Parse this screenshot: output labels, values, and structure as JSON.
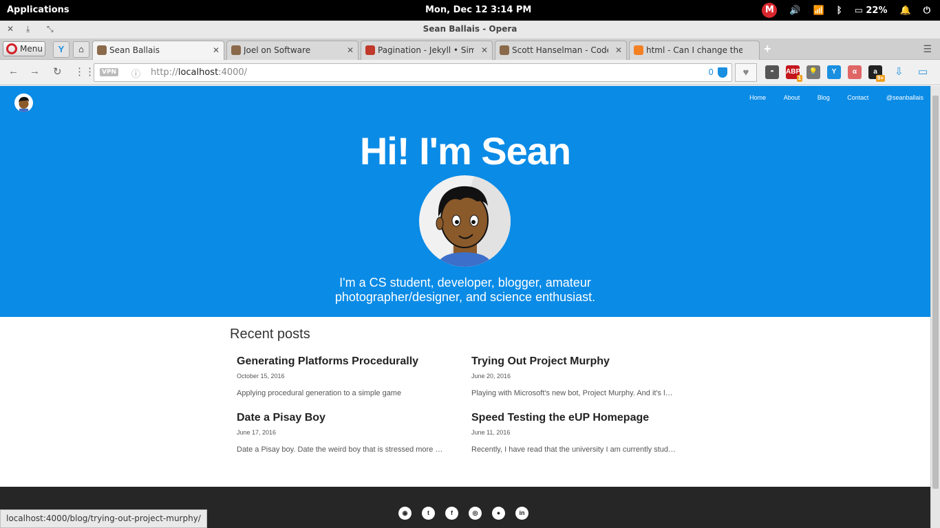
{
  "system": {
    "apps_label": "Applications",
    "clock": "Mon, Dec 12    3:14 PM",
    "battery": "22%",
    "mega_label": "M"
  },
  "window": {
    "title": "Sean Ballais - Opera"
  },
  "tabs": {
    "menu_label": "Menu",
    "items": [
      {
        "label": "Sean Ballais"
      },
      {
        "label": "Joel on Software"
      },
      {
        "label": "Pagination - Jekyll • Simpl"
      },
      {
        "label": "Scott Hanselman - Coder"
      },
      {
        "label": "html - Can I change the co"
      }
    ],
    "new_tab": "+"
  },
  "address": {
    "vpn": "VPN",
    "url_prefix": "http://",
    "url_host": "localhost",
    "url_rest": ":4000/",
    "block_count": "0"
  },
  "extensions": [
    {
      "name": "pocket-icon",
      "label": "◓",
      "color": "#555555"
    },
    {
      "name": "adblock-icon",
      "label": "ABP",
      "color": "#c4161c",
      "badge": "1"
    },
    {
      "name": "lightbulb-icon",
      "label": "💡",
      "color": "#777777"
    },
    {
      "name": "vivaldi-like-icon",
      "label": "Y",
      "color": "#1a8fe0"
    },
    {
      "name": "cs-icon",
      "label": "α",
      "color": "#e06666"
    },
    {
      "name": "amazon-icon",
      "label": "a",
      "color": "#222222",
      "badge": "9+"
    }
  ],
  "site": {
    "nav": [
      "Home",
      "About",
      "Blog",
      "Contact",
      "@seanballais"
    ],
    "hero_title": "Hi! I'm Sean",
    "tagline_1": "I'm a CS student, developer, blogger, amateur",
    "tagline_2": "photographer/designer, and science enthusiast.",
    "recent_heading": "Recent posts",
    "posts": [
      {
        "title": "Generating Platforms Procedurally",
        "date": "October 15, 2016",
        "excerpt": "Applying procedural generation to a simple game"
      },
      {
        "title": "Trying Out Project Murphy",
        "date": "June 20, 2016",
        "excerpt": "Playing with Microsoft's new bot, Project Murphy. And it's l…"
      },
      {
        "title": "Date a Pisay Boy",
        "date": "June 17, 2016",
        "excerpt": "Date a Pisay boy. Date the weird boy that is stressed more …"
      },
      {
        "title": "Speed Testing the eUP Homepage",
        "date": "June 11, 2016",
        "excerpt": "Recently, I have read that the university I am currently stud…"
      }
    ],
    "social": [
      {
        "name": "rss-icon",
        "glyph": "◉"
      },
      {
        "name": "twitter-icon",
        "glyph": "t"
      },
      {
        "name": "facebook-icon",
        "glyph": "f"
      },
      {
        "name": "github-icon",
        "glyph": "◎"
      },
      {
        "name": "reddit-icon",
        "glyph": "●"
      },
      {
        "name": "linkedin-icon",
        "glyph": "in"
      }
    ]
  },
  "status_url": "localhost:4000/blog/trying-out-project-murphy/"
}
